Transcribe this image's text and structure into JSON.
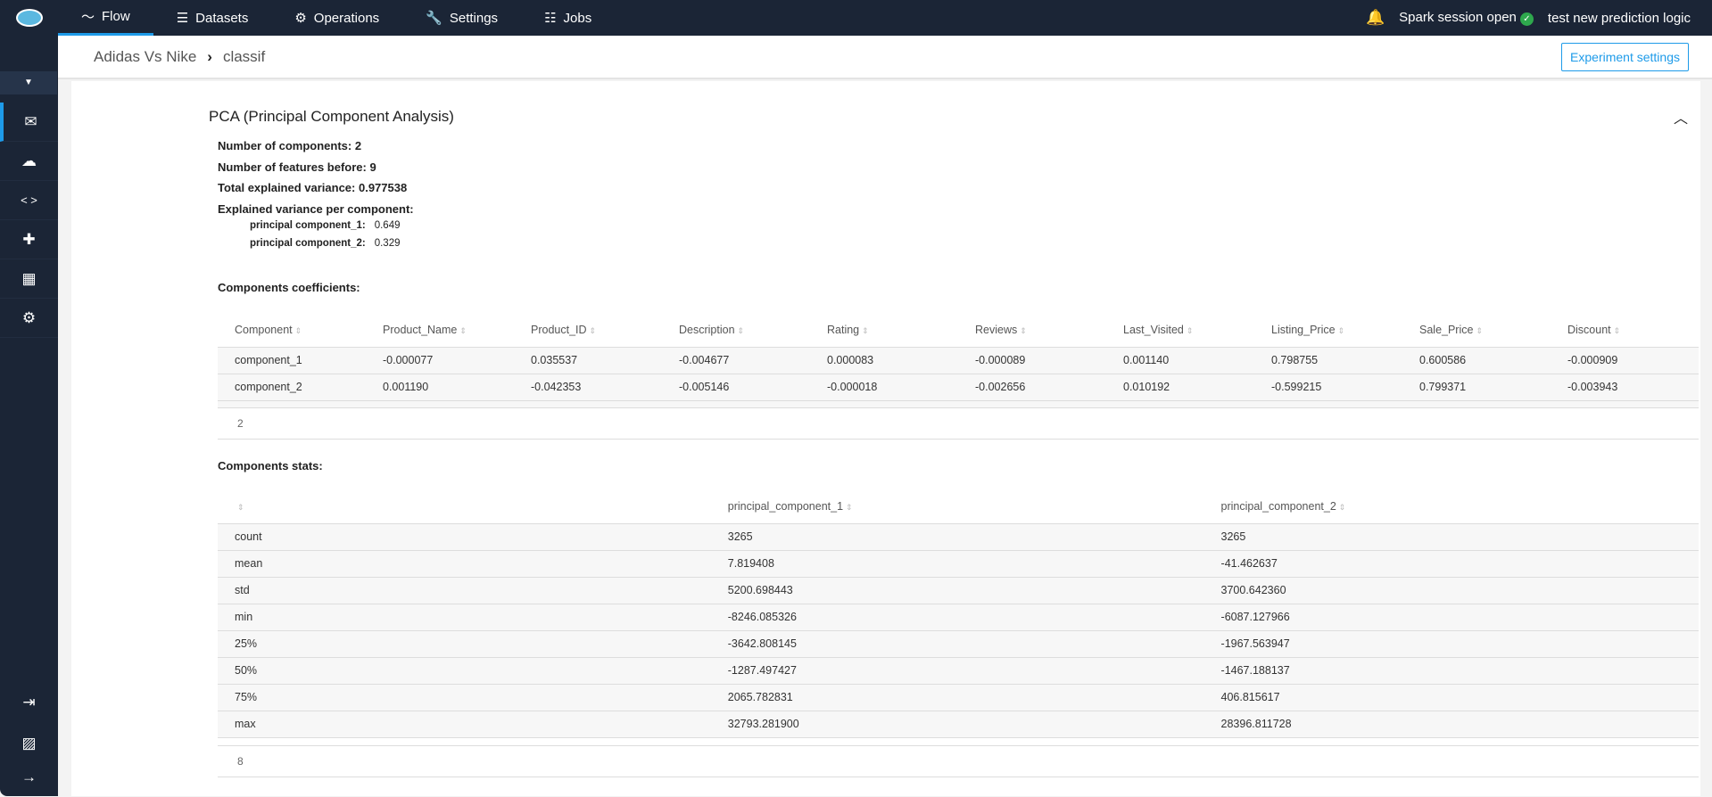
{
  "nav": {
    "items": [
      {
        "label": "Flow",
        "icon": "chart-line-icon"
      },
      {
        "label": "Datasets",
        "icon": "list-icon"
      },
      {
        "label": "Operations",
        "icon": "gear-icon"
      },
      {
        "label": "Settings",
        "icon": "wrench-icon"
      },
      {
        "label": "Jobs",
        "icon": "jobs-icon"
      }
    ],
    "spark_status": "Spark session open",
    "project": "test new prediction logic"
  },
  "breadcrumb": {
    "parent": "Adidas Vs Nike",
    "current": "classif"
  },
  "experiment_settings_label": "Experiment settings",
  "pca": {
    "title": "PCA (Principal Component Analysis)",
    "n_components": "Number of components: 2",
    "n_features": "Number of features before: 9",
    "total_var": "Total explained variance: 0.977538",
    "per_comp_label": "Explained variance per component:",
    "per_comp": [
      {
        "name": "principal component_1:",
        "value": "0.649"
      },
      {
        "name": "principal component_2:",
        "value": "0.329"
      }
    ],
    "coef_label": "Components coefficients:",
    "coef": {
      "headers": [
        "Component",
        "Product_Name",
        "Product_ID",
        "Description",
        "Rating",
        "Reviews",
        "Last_Visited",
        "Listing_Price",
        "Sale_Price",
        "Discount"
      ],
      "rows": [
        [
          "component_1",
          "-0.000077",
          "0.035537",
          "-0.004677",
          "0.000083",
          "-0.000089",
          "0.001140",
          "0.798755",
          "0.600586",
          "-0.000909"
        ],
        [
          "component_2",
          "0.001190",
          "-0.042353",
          "-0.005146",
          "-0.000018",
          "-0.002656",
          "0.010192",
          "-0.599215",
          "0.799371",
          "-0.003943"
        ]
      ],
      "count": "2"
    },
    "stats_label": "Components stats:",
    "stats": {
      "headers": [
        "",
        "principal_component_1",
        "principal_component_2"
      ],
      "rows": [
        [
          "count",
          "3265",
          "3265"
        ],
        [
          "mean",
          "7.819408",
          "-41.462637"
        ],
        [
          "std",
          "5200.698443",
          "3700.642360"
        ],
        [
          "min",
          "-8246.085326",
          "-6087.127966"
        ],
        [
          "25%",
          "-3642.808145",
          "-1967.563947"
        ],
        [
          "50%",
          "-1287.497427",
          "-1467.188137"
        ],
        [
          "75%",
          "2065.782831",
          "406.815617"
        ],
        [
          "max",
          "32793.281900",
          "28396.811728"
        ]
      ],
      "count": "8"
    }
  }
}
